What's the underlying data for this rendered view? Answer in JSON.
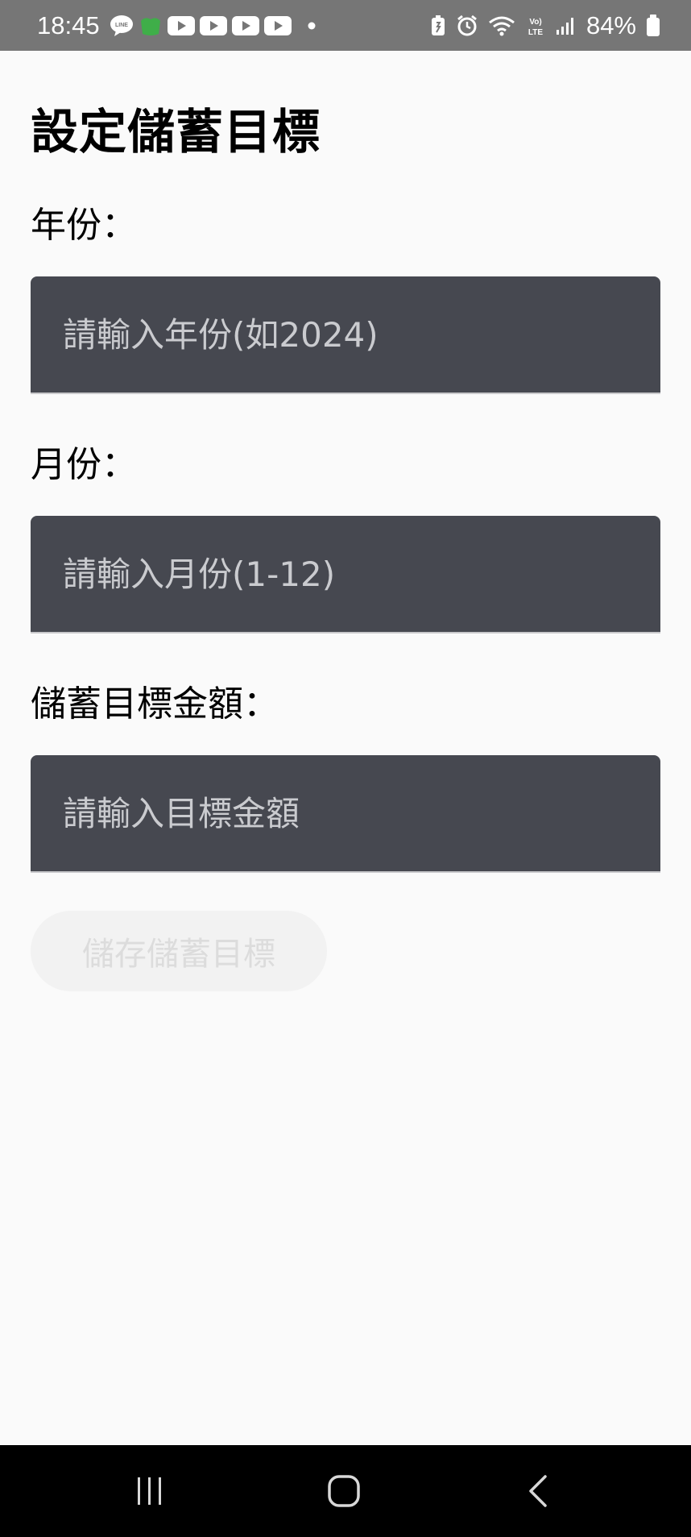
{
  "status_bar": {
    "time": "18:45",
    "battery_percent": "84%",
    "left_icons": [
      "line-icon",
      "green-app-icon",
      "youtube-icon",
      "youtube-icon",
      "youtube-icon",
      "youtube-icon",
      "dot-icon"
    ],
    "right_icons": [
      "battery-saver-icon",
      "alarm-icon",
      "wifi-icon",
      "volte-icon",
      "signal-icon",
      "battery-icon"
    ]
  },
  "page": {
    "title": "設定儲蓄目標"
  },
  "form": {
    "year_label": "年份：",
    "year_placeholder": "請輸入年份(如2024)",
    "month_label": "月份：",
    "month_placeholder": "請輸入月份(1-12)",
    "amount_label": "儲蓄目標金額：",
    "amount_placeholder": "請輸入目標金額",
    "save_button_label": "儲存儲蓄目標"
  },
  "nav_bar": {
    "buttons": [
      "recents-icon",
      "home-icon",
      "back-icon"
    ]
  },
  "colors": {
    "status_bar_bg": "#767676",
    "field_bg": "#464850",
    "page_bg": "#fafafa",
    "disabled_button_bg": "#f2f2f2"
  }
}
